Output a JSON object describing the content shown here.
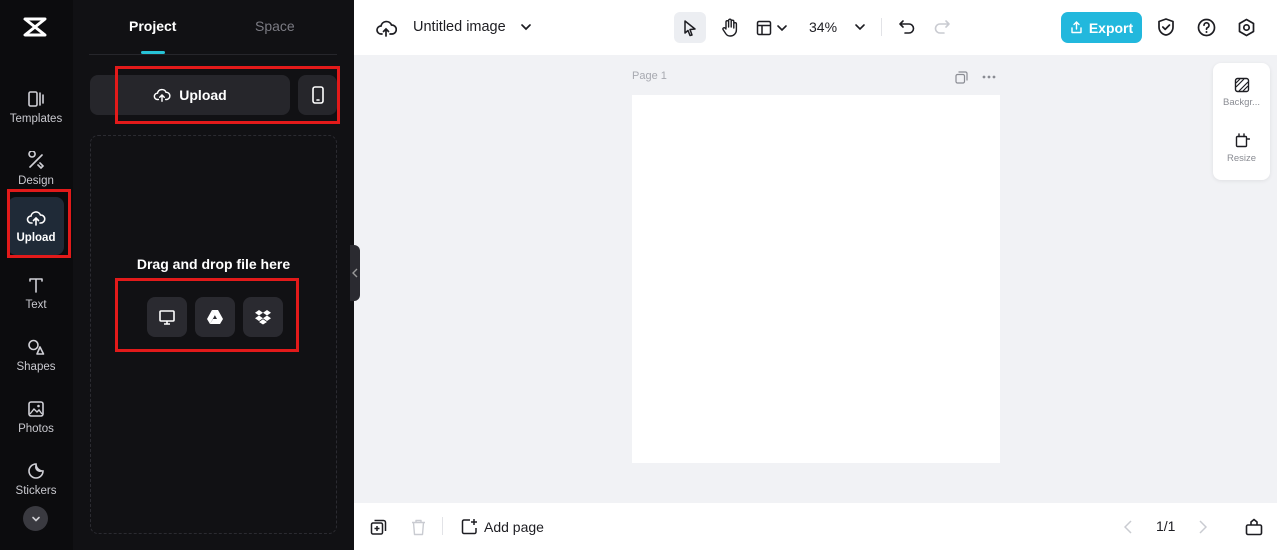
{
  "rail": {
    "items": [
      {
        "label": "Templates",
        "icon": "templates-icon"
      },
      {
        "label": "Design",
        "icon": "design-icon"
      },
      {
        "label": "Upload",
        "icon": "upload-cloud-icon",
        "active": true
      },
      {
        "label": "Text",
        "icon": "text-icon"
      },
      {
        "label": "Shapes",
        "icon": "shapes-icon"
      },
      {
        "label": "Photos",
        "icon": "photos-icon"
      },
      {
        "label": "Stickers",
        "icon": "stickers-icon"
      }
    ]
  },
  "panel": {
    "tabs": [
      {
        "label": "Project",
        "active": true
      },
      {
        "label": "Space",
        "active": false
      }
    ],
    "upload_label": "Upload",
    "drop_text": "Drag and drop file here",
    "sources": [
      "computer-icon",
      "google-drive-icon",
      "dropbox-icon"
    ]
  },
  "topbar": {
    "doc_title": "Untitled image",
    "zoom": "34%",
    "export_label": "Export"
  },
  "canvas": {
    "page_label": "Page 1"
  },
  "float_panel": {
    "items": [
      {
        "label": "Backgr...",
        "icon": "background-icon"
      },
      {
        "label": "Resize",
        "icon": "resize-icon"
      }
    ]
  },
  "bottombar": {
    "add_page_label": "Add page",
    "pager": "1/1"
  },
  "colors": {
    "accent": "#22b8dd",
    "tab_underline": "#27c2d6",
    "highlight": "#e21a1a"
  }
}
